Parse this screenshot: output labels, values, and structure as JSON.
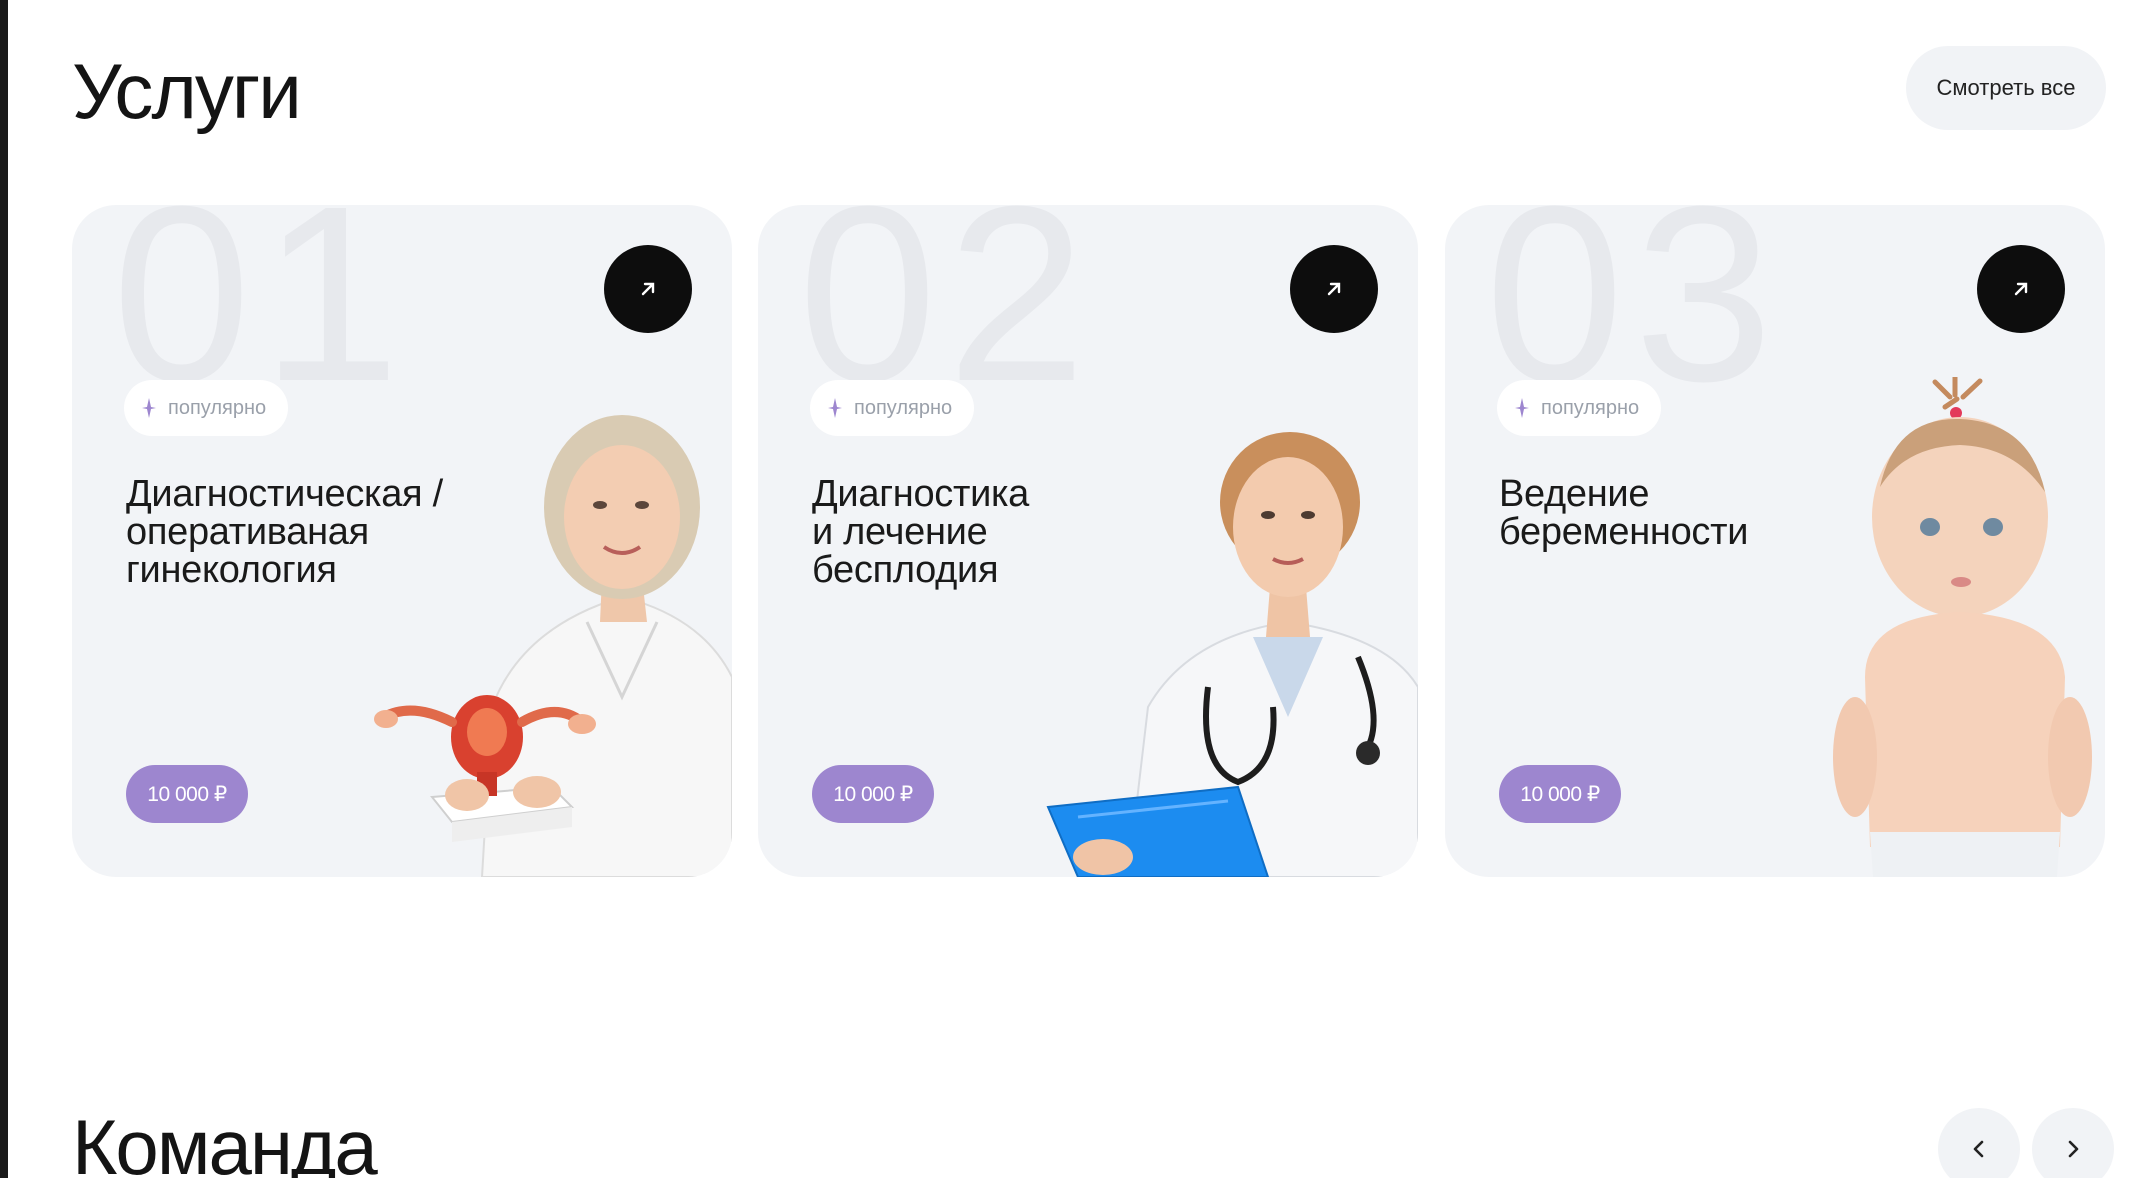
{
  "services": {
    "title": "Услуги",
    "view_all_label": "Смотреть все",
    "cards": [
      {
        "number": "01",
        "badge": "популярно",
        "title": "Диагностическая /\nоперативаная\nгинекология",
        "price": "10 000 ₽"
      },
      {
        "number": "02",
        "badge": "популярно",
        "title": "Диагностика\nи лечение\nбесплодия",
        "price": "10 000 ₽"
      },
      {
        "number": "03",
        "badge": "популярно",
        "title": "Ведение\nбеременности",
        "price": "10 000 ₽"
      }
    ]
  },
  "team": {
    "title": "Команда"
  },
  "colors": {
    "card_bg": "#f2f4f7",
    "price_pill": "#9d86cf",
    "arrow_button": "#0d0d0d",
    "badge_icon": "#9d86cf"
  },
  "icons": {
    "card_link": "arrow-up-right-icon",
    "badge": "sparkle-icon",
    "nav_prev": "chevron-left-icon",
    "nav_next": "chevron-right-icon"
  }
}
